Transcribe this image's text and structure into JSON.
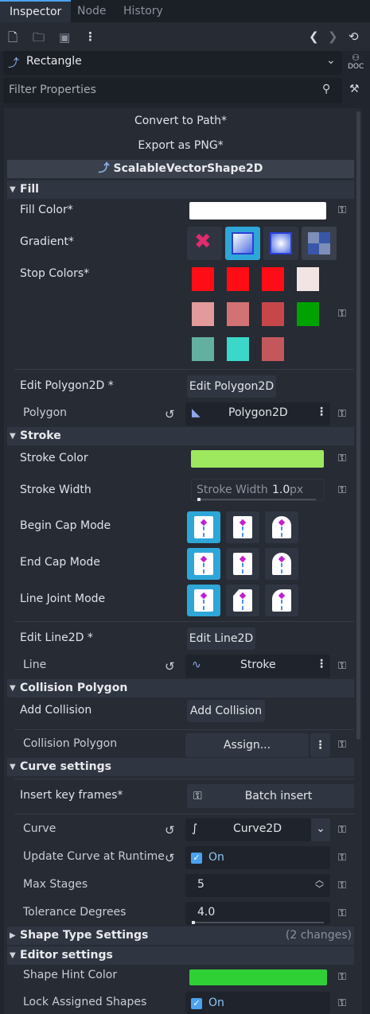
{
  "tabs": [
    "Inspector",
    "Node",
    "History"
  ],
  "toolbar": {
    "icons": [
      "new-resource-icon",
      "open-folder-icon",
      "save-icon",
      "more-vertical-icon",
      "history-back-icon",
      "history-forward-icon",
      "object-history-icon"
    ]
  },
  "object_selector": {
    "label": "Rectangle",
    "doc_label": "DOC"
  },
  "filter": {
    "placeholder": "Filter Properties"
  },
  "actions": {
    "convert": "Convert to Path*",
    "export": "Export as PNG*",
    "class_name": "ScalableVectorShape2D"
  },
  "fill": {
    "section": "Fill",
    "fill_color_label": "Fill Color*",
    "fill_color": "#ffffff",
    "gradient_label": "Gradient*",
    "stop_colors_label": "Stop Colors*",
    "stop_colors": [
      "#ff0d16",
      "#ff0d16",
      "#ff0d16",
      "#f1e4e3",
      "#e29a9b",
      "#d37274",
      "#c7464a",
      "#00a200",
      "#63b0a1",
      "#3bd8c9",
      "#c4575b"
    ],
    "edit_polygon_label": "Edit Polygon2D *",
    "edit_polygon_button": "Edit Polygon2D",
    "polygon_label": "Polygon",
    "polygon_value": "Polygon2D"
  },
  "stroke": {
    "section": "Stroke",
    "stroke_color_label": "Stroke Color",
    "stroke_color": "#9ee860",
    "stroke_width_label": "Stroke Width",
    "stroke_width_inner": "Stroke Width",
    "stroke_width_value": "1.0",
    "stroke_width_unit": "px",
    "begin_cap_label": "Begin Cap Mode",
    "end_cap_label": "End Cap Mode",
    "line_joint_label": "Line Joint Mode",
    "edit_line_label": "Edit Line2D *",
    "edit_line_button": "Edit Line2D",
    "line_label": "Line",
    "line_value": "Stroke"
  },
  "collision": {
    "section": "Collision Polygon",
    "add_label": "Add Collision",
    "add_button": "Add Collision",
    "poly_label": "Collision Polygon",
    "assign": "Assign..."
  },
  "curve": {
    "section": "Curve settings",
    "insert_label": "Insert key frames*",
    "batch": "Batch insert",
    "curve_label": "Curve",
    "curve_value": "Curve2D",
    "runtime_label": "Update Curve at Runtime",
    "runtime_value": "On",
    "max_stages_label": "Max Stages",
    "max_stages_value": "5",
    "tolerance_label": "Tolerance Degrees",
    "tolerance_value": "4.0"
  },
  "shape_type": {
    "section": "Shape Type Settings",
    "changes": "(2 changes)"
  },
  "editor": {
    "section": "Editor settings",
    "hint_label": "Shape Hint Color",
    "hint_color": "#2fd036",
    "lock_label": "Lock Assigned Shapes",
    "lock_value": "On"
  }
}
